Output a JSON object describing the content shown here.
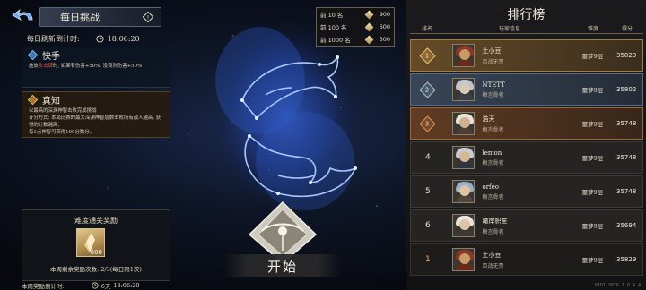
{
  "header": {
    "title": "每日挑战",
    "refresh_label": "每日刷新倒计时:",
    "refresh_time": "18:06:20"
  },
  "cards": {
    "quick": {
      "title": "快手",
      "text_pre": "施放",
      "text_hl": "攻击牌",
      "text_post": "时, 如果有伤害+50%, 没有则伤害+50%"
    },
    "truth": {
      "title": "真知",
      "line1": "以最高的深渊神智击败完成挑战",
      "line2": "计分方式: 本局比赛的最大深渊神智层数击败所有敌人越高, 获得的分数越高;",
      "line3": "每1点神智可获得100分数分。"
    }
  },
  "reward": {
    "title": "难度通关奖励",
    "quantity": "600",
    "claim_count": "本周剩余奖励次数: 2/3(每日限1次)"
  },
  "week": {
    "label": "本周奖励倒计时:",
    "days": "6天",
    "time": "18:06:20"
  },
  "tiers": [
    {
      "label": "前 10 名",
      "points": "900"
    },
    {
      "label": "前 100 名",
      "points": "600"
    },
    {
      "label": "前 1000 名",
      "points": "300"
    }
  ],
  "start_label": "开始",
  "leaderboard": {
    "title": "排行榜",
    "columns": {
      "rank": "排名",
      "info": "玩家信息",
      "difficulty": "难度",
      "score": "得分"
    },
    "rows": [
      {
        "rank": "1",
        "name": "土小豆",
        "guild": "百战无畏",
        "difficulty": "噩梦9层",
        "score": "35829",
        "style": "gold"
      },
      {
        "rank": "2",
        "name": "NTETT",
        "guild": "梅言骨者",
        "difficulty": "噩梦9层",
        "score": "35802",
        "style": "blue"
      },
      {
        "rank": "3",
        "name": "浩天",
        "guild": "梅言骨者",
        "difficulty": "噩梦9层",
        "score": "35748",
        "style": "bronze"
      },
      {
        "rank": "4",
        "name": "lemon",
        "guild": "梅言骨者",
        "difficulty": "噩梦9层",
        "score": "35748",
        "style": "plain"
      },
      {
        "rank": "5",
        "name": "orfeo",
        "guild": "梅言骨者",
        "difficulty": "噩梦9层",
        "score": "35748",
        "style": "plain"
      },
      {
        "rank": "6",
        "name": "瞰岸帜笙",
        "guild": "梅言骨者",
        "difficulty": "噩梦9层",
        "score": "35694",
        "style": "plain"
      },
      {
        "rank": "1",
        "name": "土小豆",
        "guild": "百战无畏",
        "difficulty": "噩梦9层",
        "score": "35829",
        "style": "self"
      }
    ],
    "version": "PID113076.1.0.4.4"
  },
  "colors": {
    "accent_gold": "#e6b450",
    "highlight_red": "#e55a3c",
    "constellation_blue": "#4a7cff"
  }
}
